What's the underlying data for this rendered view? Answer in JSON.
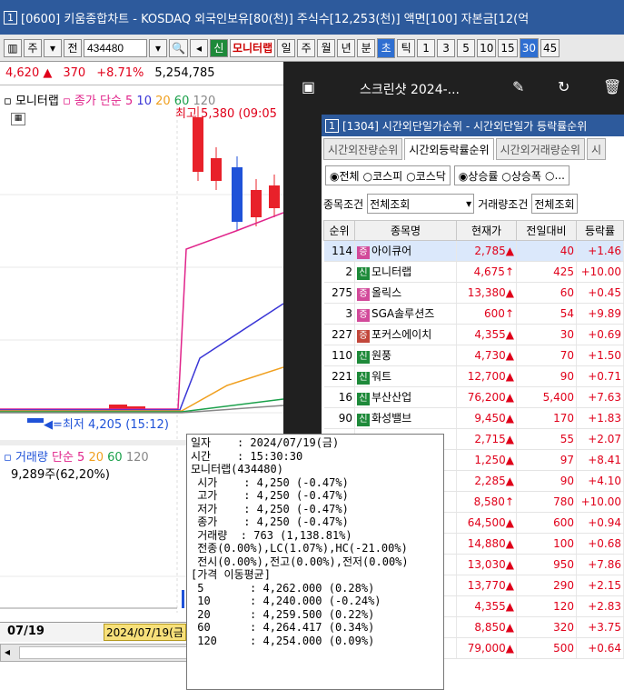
{
  "window": {
    "title": "[0600] 키움종합차트 - KOSDAQ 외국인보유[80(천)] 주식수[12,253(천)] 액면[100] 자본금[12(억",
    "number": "1"
  },
  "toolbar": {
    "menu_label": "주",
    "code_label": "전",
    "code": "434480",
    "stock_badge": "신",
    "stock_name": "모니터랩",
    "periods": [
      "일",
      "주",
      "월",
      "년",
      "분",
      "초",
      "틱"
    ],
    "intervals": [
      "1",
      "3",
      "5",
      "10",
      "15",
      "30",
      "45"
    ],
    "active_interval": "30",
    "active_period": "초"
  },
  "price_bar": {
    "price": "4,620",
    "change": "370",
    "change_rate": "+8.71%",
    "volume": "5,254,785"
  },
  "chart": {
    "legend_name": "모니터랩",
    "legend_ma": "종가 단순 5",
    "legend_periods": [
      "10",
      "20",
      "60",
      "120"
    ],
    "high_label": "최고 5,380 (09:05",
    "low_label": "최저 4,205 (15:12)",
    "volume_legend": "거래량",
    "volume_ma": "단순 5",
    "volume_periods": [
      "20",
      "60",
      "120"
    ],
    "volume_text": "9,289주(62,20%)",
    "date_left": "07/19",
    "date_box": "2024/07/19(금",
    "colors": {
      "up": "#e8212a",
      "down": "#1f52d8",
      "ma5": "#e0238a",
      "ma10": "#3a36d6",
      "ma20": "#f0a020",
      "ma60": "#1aa04a",
      "ma120": "#888888"
    }
  },
  "overlay": {
    "title": "스크린샷 2024-...",
    "icons": [
      "image-icon",
      "edit-icon",
      "rotate-icon",
      "trash-icon"
    ]
  },
  "inner": {
    "number": "1",
    "title": "[1304] 시간외단일가순위 - 시간외단일가 등락률순위",
    "tabs": [
      "시간외잔량순위",
      "시간외등락률순위",
      "시간외거래량순위",
      "시"
    ],
    "active_tab": "시간외등락률순위",
    "market_options": [
      "전체",
      "코스피",
      "코스닥"
    ],
    "selected_market": "전체",
    "sort_options": [
      "상승률",
      "상승폭",
      "..."
    ],
    "selected_sort": "상승률",
    "condition_label": "종목조건",
    "condition_value": "전체조회",
    "volume_cond_label": "거래량조건",
    "volume_cond_value": "전체조회",
    "columns": [
      "순위",
      "종목명",
      "현재가",
      "전일대비",
      "등락률"
    ],
    "rows": [
      {
        "rank": "114",
        "badge": "증",
        "badge_type": "pk",
        "name": "아이큐어",
        "price": "2,785",
        "sym": "▲",
        "diff": "40",
        "rate": "+1.46"
      },
      {
        "rank": "2",
        "badge": "신",
        "badge_type": "gr",
        "name": "모니터랩",
        "price": "4,675",
        "sym": "↑",
        "diff": "425",
        "rate": "+10.00"
      },
      {
        "rank": "275",
        "badge": "증",
        "badge_type": "pk",
        "name": "올릭스",
        "price": "13,380",
        "sym": "▲",
        "diff": "60",
        "rate": "+0.45"
      },
      {
        "rank": "3",
        "badge": "증",
        "badge_type": "pk",
        "name": "SGA솔루션즈",
        "price": "600",
        "sym": "↑",
        "diff": "54",
        "rate": "+9.89"
      },
      {
        "rank": "227",
        "badge": "증",
        "badge_type": "rd",
        "name": "포커스에이치",
        "price": "4,355",
        "sym": "▲",
        "diff": "30",
        "rate": "+0.69"
      },
      {
        "rank": "110",
        "badge": "신",
        "badge_type": "gr",
        "name": "원풍",
        "price": "4,730",
        "sym": "▲",
        "diff": "70",
        "rate": "+1.50"
      },
      {
        "rank": "221",
        "badge": "신",
        "badge_type": "gr",
        "name": "워트",
        "price": "12,700",
        "sym": "▲",
        "diff": "90",
        "rate": "+0.71"
      },
      {
        "rank": "16",
        "badge": "신",
        "badge_type": "gr",
        "name": "부산산업",
        "price": "76,200",
        "sym": "▲",
        "diff": "5,400",
        "rate": "+7.63"
      },
      {
        "rank": "90",
        "badge": "신",
        "badge_type": "gr",
        "name": "화성밸브",
        "price": "9,450",
        "sym": "▲",
        "diff": "170",
        "rate": "+1.83"
      },
      {
        "rank": "",
        "badge": "",
        "badge_type": "",
        "name": "",
        "price": "2,715",
        "sym": "▲",
        "diff": "55",
        "rate": "+2.07"
      },
      {
        "rank": "",
        "badge": "",
        "badge_type": "",
        "name": "",
        "price": "1,250",
        "sym": "▲",
        "diff": "97",
        "rate": "+8.41"
      },
      {
        "rank": "",
        "badge": "",
        "badge_type": "",
        "name": "",
        "price": "2,285",
        "sym": "▲",
        "diff": "90",
        "rate": "+4.10"
      },
      {
        "rank": "",
        "badge": "",
        "badge_type": "",
        "name": "",
        "price": "8,580",
        "sym": "↑",
        "diff": "780",
        "rate": "+10.00"
      },
      {
        "rank": "",
        "badge": "",
        "badge_type": "",
        "name": "",
        "price": "64,500",
        "sym": "▲",
        "diff": "600",
        "rate": "+0.94"
      },
      {
        "rank": "",
        "badge": "",
        "badge_type": "",
        "name": "",
        "price": "14,880",
        "sym": "▲",
        "diff": "100",
        "rate": "+0.68"
      },
      {
        "rank": "",
        "badge": "",
        "badge_type": "",
        "name": "스",
        "price": "13,030",
        "sym": "▲",
        "diff": "950",
        "rate": "+7.86"
      },
      {
        "rank": "",
        "badge": "",
        "badge_type": "",
        "name": "",
        "price": "13,770",
        "sym": "▲",
        "diff": "290",
        "rate": "+2.15"
      },
      {
        "rank": "",
        "badge": "",
        "badge_type": "",
        "name": "시",
        "price": "4,355",
        "sym": "▲",
        "diff": "120",
        "rate": "+2.83"
      },
      {
        "rank": "",
        "badge": "",
        "badge_type": "",
        "name": "",
        "price": "8,850",
        "sym": "▲",
        "diff": "320",
        "rate": "+3.75"
      },
      {
        "rank": "",
        "badge": "",
        "badge_type": "",
        "name": "켁",
        "price": "79,000",
        "sym": "▲",
        "diff": "500",
        "rate": "+0.64"
      }
    ]
  },
  "tooltip": {
    "lines": [
      "일자    : 2024/07/19(금)",
      "시간    : 15:30:30",
      "모니터랩(434480)",
      " 시가    : 4,250 (-0.47%)",
      " 고가    : 4,250 (-0.47%)",
      " 저가    : 4,250 (-0.47%)",
      " 종가    : 4,250 (-0.47%)",
      " 거래량  : 763 (1,138.81%)",
      " 전종(0.00%),LC(1.07%),HC(-21.00%)",
      " 전시(0.00%),전고(0.00%),전저(0.00%)",
      "[가격 이동평균]",
      " 5       : 4,262.000 (0.28%)",
      " 10      : 4,240.000 (-0.24%)",
      " 20      : 4,259.500 (0.22%)",
      " 60      : 4,264.417 (0.34%)",
      " 120     : 4,254.000 (0.09%)"
    ]
  }
}
